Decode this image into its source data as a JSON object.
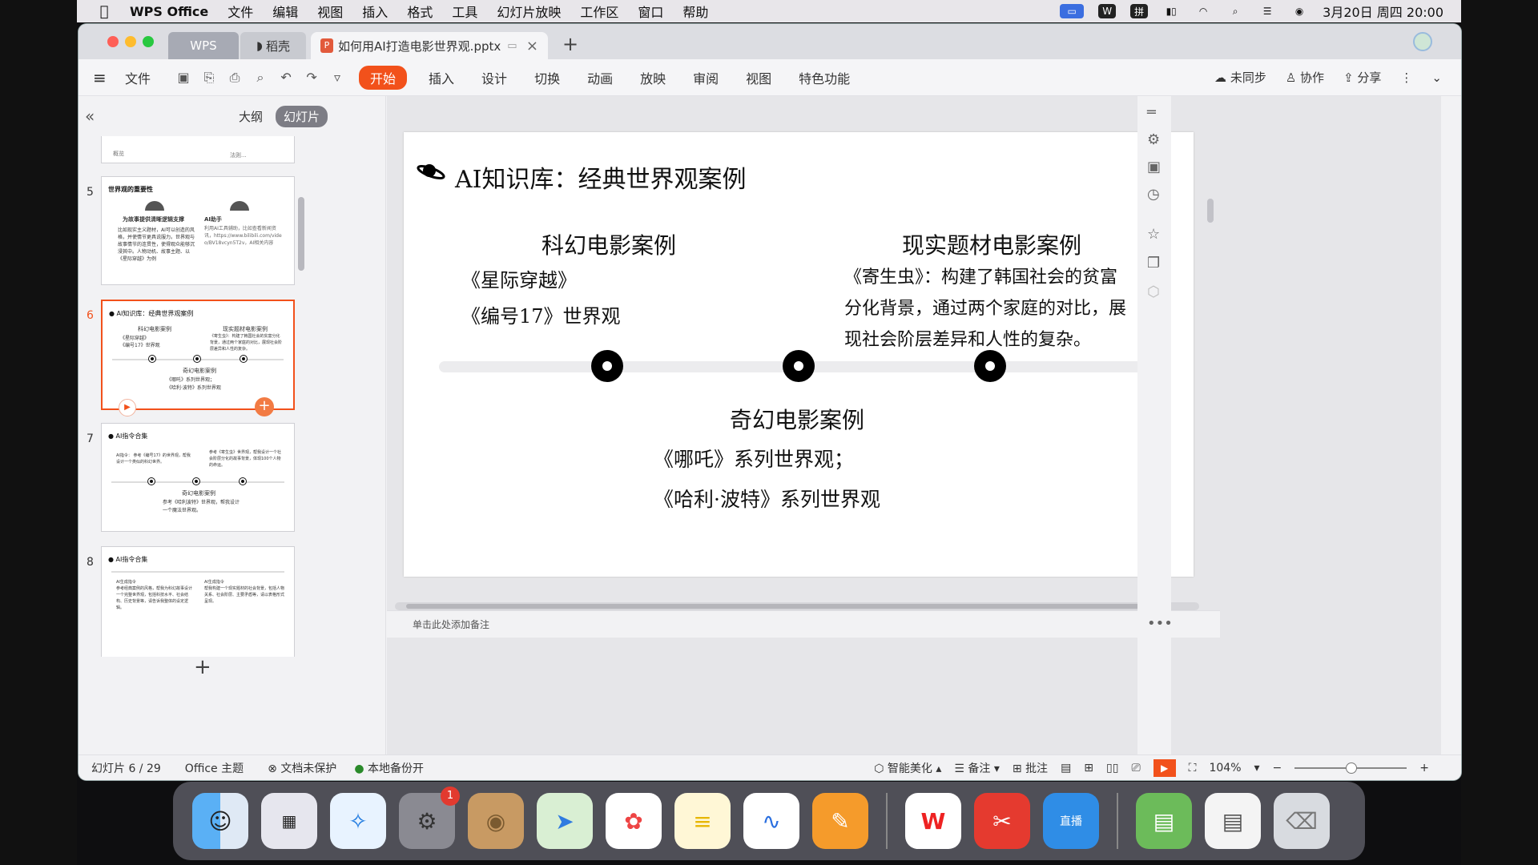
{
  "menubar": {
    "app": "WPS Office",
    "items": [
      "文件",
      "编辑",
      "视图",
      "插入",
      "格式",
      "工具",
      "幻灯片放映",
      "工作区",
      "窗口",
      "帮助"
    ],
    "clock": "3月20日 周四  20:00",
    "status_icons": [
      "screen-mirror",
      "wps-w",
      "input-pinyin",
      "battery",
      "wifi",
      "search",
      "control-center",
      "siri"
    ]
  },
  "window": {
    "tabs": [
      {
        "label": "WPS"
      },
      {
        "label": "稻壳"
      },
      {
        "label": "如何用AI打造电影世界观.pptx"
      }
    ]
  },
  "toolbar": {
    "file_label": "文件",
    "tabs": [
      "开始",
      "插入",
      "设计",
      "切换",
      "动画",
      "放映",
      "审阅",
      "视图",
      "特色功能"
    ],
    "active_tab": "开始",
    "right": {
      "sync": "未同步",
      "collab": "协作",
      "share": "分享"
    }
  },
  "left_panel": {
    "mode_outline": "大纲",
    "mode_slides": "幻灯片",
    "top_fragment": [
      "概览",
      "法则..."
    ],
    "slide5": {
      "num": "5",
      "title": "世界观的重要性",
      "left_head": "为故事提供清晰逻辑支撑",
      "left_body": "比如现实主义题材，AI可以创造的风格，并使情节更具说服力。世界观与故事情节的连贯性，使得观众能够沉浸其中。人物动机、故事主题、以《星际穿越》为例",
      "right_head": "AI助手",
      "right_body": "利用AI工具辅助，比如查看新闻资讯，https://www.bilibili.com/video/BV18vcyn5T2v，AI相关内容"
    },
    "slide6": {
      "num": "6",
      "title": "AI知识库：经典世界观案例",
      "col1": "科幻电影案例",
      "col1_body": "《星际穿越》\n《编号17》世界观",
      "col2": "现实题材电影案例",
      "col2_body": "《寄生虫》：构建了韩国社会的贫富分化背景，通过两个家庭的对比，展现社会阶层差异和人性的复杂。",
      "col3": "奇幻电影案例",
      "col3_body": "《哪吒》系列世界观；\n《哈利·波特》系列世界观"
    },
    "slide7": {
      "num": "7",
      "title": "AI指令合集",
      "left_body": "AI指令：\n参考《编号17》的世界观，帮我设计一个类似的科幻世界。",
      "right_body": "参考《寄生虫》世界观，帮我设计一个社会阶层分化的故事背景，体现100个人物的命运。",
      "center": "奇幻电影案例",
      "center_body": "参考《哈利波特》世界观，帮我设计一个魔法世界观。"
    },
    "slide8": {
      "num": "8",
      "title": "AI指令合集",
      "left_body": "AI生成指令\n参考经典案例的风格，帮我为科幻故事设计一个完整世界观，包括科技水平、社会结构、历史背景等，请告诉我整体的设定逻辑。",
      "right_body": "AI生成指令\n帮我构建一个现实题材的社会背景，包括人物关系、社会阶层、主要矛盾等，请以表格形式呈现。"
    }
  },
  "slide": {
    "title": "AI知识库：经典世界观案例",
    "sci_fi": {
      "heading": "科幻电影案例",
      "lines": [
        "《星际穿越》",
        "《编号17》世界观"
      ]
    },
    "realism": {
      "heading": "现实题材电影案例",
      "lines": [
        "《寄生虫》：构建了韩国社会的贫富",
        "分化背景，通过两个家庭的对比，展",
        "现社会阶层差异和人性的复杂。"
      ]
    },
    "fantasy": {
      "heading": "奇幻电影案例",
      "lines": [
        "《哪吒》系列世界观；",
        "《哈利·波特》系列世界观"
      ]
    }
  },
  "notes_placeholder": "单击此处添加备注",
  "statusbar": {
    "slide_counter": "幻灯片 6 / 29",
    "theme": "Office 主题",
    "protect": "文档未保护",
    "backup": "本地备份开",
    "beautify": "智能美化",
    "notes": "备注",
    "comment": "批注",
    "zoom": "104%"
  },
  "dock": {
    "apps": [
      "finder",
      "launchpad",
      "safari",
      "system-settings",
      "contacts",
      "maps",
      "photos",
      "notes",
      "freeform",
      "pages",
      "wps-office",
      "wps-slides",
      "live-stream",
      "numbers-file",
      "document-file",
      "trash"
    ],
    "settings_badge": "1",
    "live_label": "直播"
  },
  "colors": {
    "accent": "#f2511b",
    "timeline": "#ececee"
  }
}
